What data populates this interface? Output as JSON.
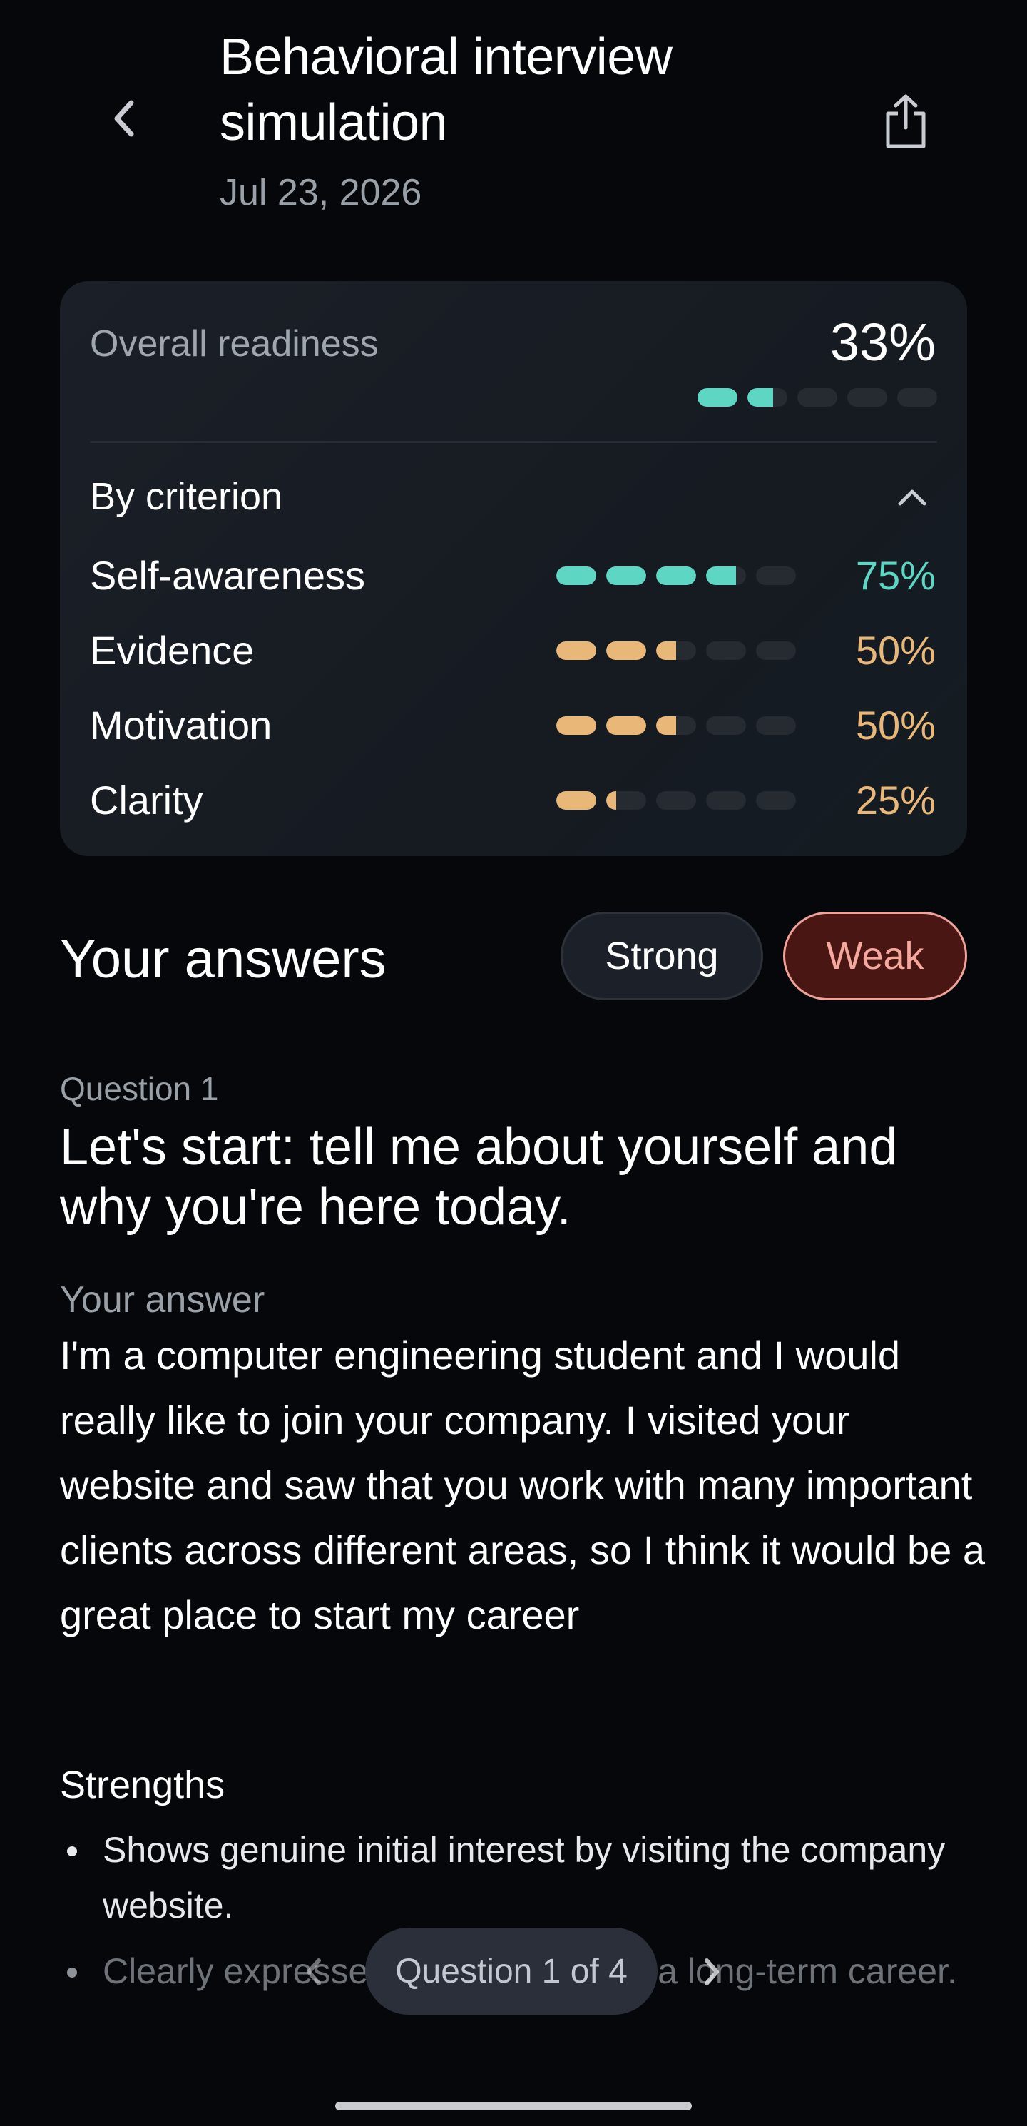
{
  "header": {
    "title": "Behavioral interview simulation",
    "date": "Jul 23, 2026"
  },
  "overall": {
    "label": "Overall readiness",
    "value": "33%",
    "fraction": 0.33,
    "color": "#5ed6c4"
  },
  "criteria": {
    "label": "By criterion",
    "items": [
      {
        "name": "Self-awareness",
        "pct": "75%",
        "fraction": 0.75,
        "color": "#5ed6c4"
      },
      {
        "name": "Evidence",
        "pct": "50%",
        "fraction": 0.5,
        "color": "#e9b878"
      },
      {
        "name": "Motivation",
        "pct": "50%",
        "fraction": 0.5,
        "color": "#e9b878"
      },
      {
        "name": "Clarity",
        "pct": "25%",
        "fraction": 0.25,
        "color": "#e9b878"
      }
    ]
  },
  "answers": {
    "title": "Your answers",
    "filters": {
      "strong": "Strong",
      "weak": "Weak"
    }
  },
  "question": {
    "label": "Question 1",
    "text": "Let's start: tell me about yourself and why you're here today.",
    "answer_label": "Your answer",
    "answer_text": "I'm a computer engineering student and I would really like to join your company. I visited your website and saw that you work with many important clients across different areas, so I think it would be a great place to start my career",
    "strengths_title": "Strengths",
    "strengths": [
      "Shows genuine initial interest by visiting the company website.",
      "Clearly expresses a desire to build a long-term career."
    ]
  },
  "pager": {
    "label": "Question 1 of 4"
  },
  "colors": {
    "background": "#05070b",
    "card": "#1b1f27",
    "teal": "#5ed6c4",
    "amber": "#e9b878",
    "weak_bg": "#4a1614",
    "weak_border": "#f0a39a"
  }
}
